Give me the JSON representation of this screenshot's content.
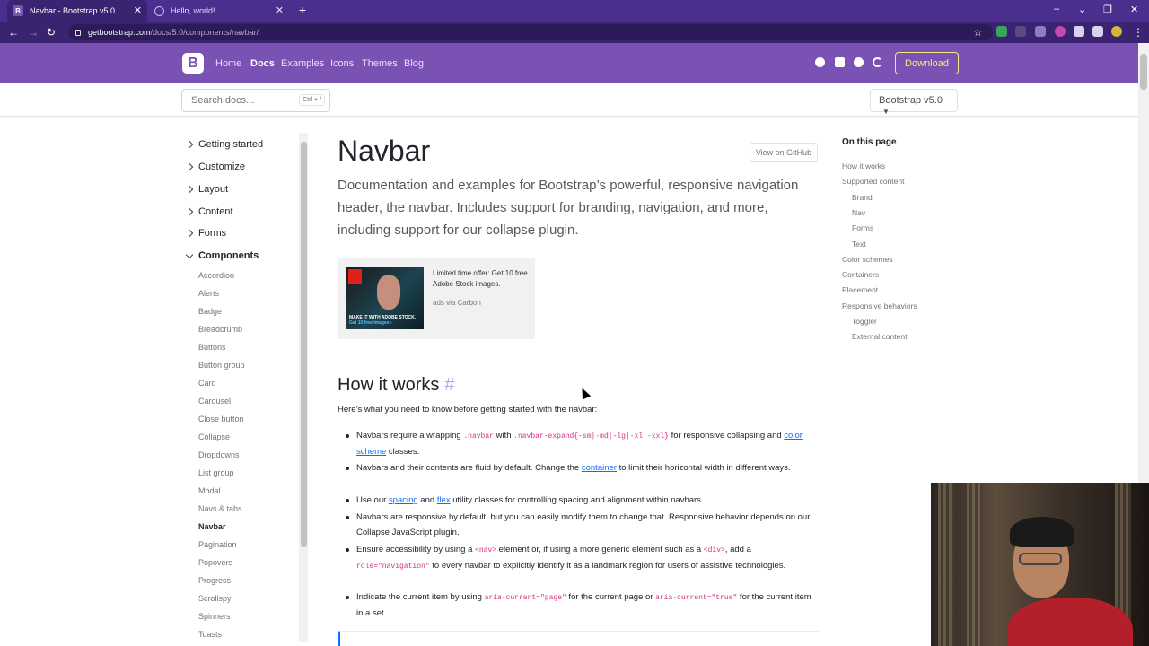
{
  "browser": {
    "tabs": [
      {
        "title": "Navbar - Bootstrap v5.0",
        "favicon": "B"
      },
      {
        "title": "Hello, world!"
      }
    ],
    "new_tab": "+",
    "url_host": "getbootstrap.com",
    "url_path": "/docs/5.0/components/navbar/"
  },
  "navbar": {
    "logo": "B",
    "links": [
      "Home",
      "Docs",
      "Examples",
      "Icons",
      "Themes",
      "Blog"
    ],
    "active_link": "Docs",
    "download": "Download"
  },
  "subnav": {
    "search_placeholder": "Search docs...",
    "search_shortcut": "Ctrl + /",
    "version": "Bootstrap v5.0"
  },
  "sidebar": {
    "groups": [
      "Getting started",
      "Customize",
      "Layout",
      "Content",
      "Forms",
      "Components"
    ],
    "expanded_group": "Components",
    "items": [
      "Accordion",
      "Alerts",
      "Badge",
      "Breadcrumb",
      "Buttons",
      "Button group",
      "Card",
      "Carousel",
      "Close button",
      "Collapse",
      "Dropdowns",
      "List group",
      "Modal",
      "Navs & tabs",
      "Navbar",
      "Pagination",
      "Popovers",
      "Progress",
      "Scrollspy",
      "Spinners",
      "Toasts"
    ],
    "current_item": "Navbar"
  },
  "main": {
    "title": "Navbar",
    "github_button": "View on GitHub",
    "lead": "Documentation and examples for Bootstrap’s powerful, responsive navigation header, the navbar. Includes support for branding, navigation, and more, including support for our collapse plugin.",
    "ad": {
      "text": "Limited time offer: Get 10 free Adobe Stock images.",
      "via": "ads via Carbon",
      "image_caption": "MAKE IT WITH ADOBE STOCK.",
      "image_sub": "Get 10 free images ›",
      "image_logo": "Adobe"
    },
    "section_title": "How it works",
    "section_anchor": "#",
    "intro": "Here’s what you need to know before getting started with the navbar:",
    "bullets": {
      "b1": {
        "t1": "Navbars require a wrapping ",
        "c1": ".navbar",
        "t2": " with ",
        "c2": ".navbar-expand{-sm|-md|-lg|-xl|-xxl}",
        "t3": " for responsive collapsing and ",
        "l1": "color scheme",
        "t4": " classes."
      },
      "b2": {
        "t1": "Navbars and their contents are fluid by default. Change the ",
        "l1": "container",
        "t2": " to limit their horizontal width in different ways."
      },
      "b3": {
        "t1": "Use our ",
        "l1": "spacing",
        "t2": " and ",
        "l2": "flex",
        "t3": " utility classes for controlling spacing and alignment within navbars."
      },
      "b4": {
        "t1": "Navbars are responsive by default, but you can easily modify them to change that. Responsive behavior depends on our Collapse JavaScript plugin."
      },
      "b5": {
        "t1": "Ensure accessibility by using a ",
        "c1": "<nav>",
        "t2": " element or, if using a more generic element such as a ",
        "c2": "<div>",
        "t3": ", add a ",
        "c3": "role=\"navigation\"",
        "t4": " to every navbar to explicitly identify it as a landmark region for users of assistive technologies."
      },
      "b6": {
        "t1": "Indicate the current item by using ",
        "c1": "aria-current=\"page\"",
        "t2": " for the current page or ",
        "c2": "aria-current=\"true\"",
        "t3": " for the current item in a set."
      }
    }
  },
  "toc": {
    "heading": "On this page",
    "items": [
      "How it works",
      "Supported content",
      "Brand",
      "Nav",
      "Forms",
      "Text",
      "Color schemes",
      "Containers",
      "Placement",
      "Responsive behaviors",
      "Toggler",
      "External content"
    ]
  },
  "colors": {
    "brand": "#7952b3",
    "browser_frame": "#4b2f8f",
    "download": "#ffe484",
    "link": "#0d6efd",
    "code": "#d63384"
  },
  "icons": [
    "github-icon",
    "twitter-icon",
    "slack-icon",
    "opencollective-icon",
    "lock-icon",
    "star-icon",
    "extensions-icon",
    "chevron-right-icon",
    "chevron-down-icon"
  ]
}
